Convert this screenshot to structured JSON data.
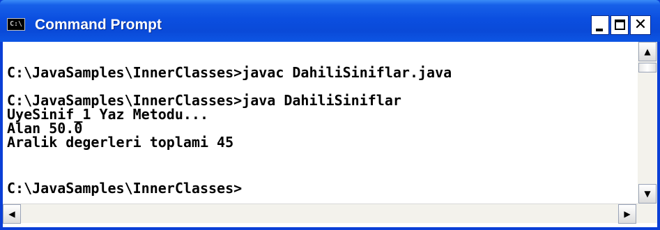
{
  "window": {
    "title": "Command Prompt",
    "icon": "cmd-icon",
    "icon_text": "C:\\",
    "buttons": {
      "minimize": "minimize-icon",
      "maximize": "maximize-icon",
      "close": "close-icon",
      "close_glyph": "✕"
    }
  },
  "console": {
    "lines": [
      "",
      "C:\\JavaSamples\\InnerClasses>javac DahiliSiniflar.java",
      "",
      "C:\\JavaSamples\\InnerClasses>java DahiliSiniflar",
      "UyeSinif_1 Yaz Metodu...",
      "Alan 50.0",
      "Aralik degerleri toplami 45",
      "",
      "C:\\JavaSamples\\InnerClasses>"
    ]
  },
  "scrollbars": {
    "up": "▲",
    "down": "▼",
    "left": "◀",
    "right": "▶"
  },
  "colors": {
    "titlebar": "#0a4ad8",
    "console_bg": "#ffffff",
    "console_text": "#000000"
  }
}
